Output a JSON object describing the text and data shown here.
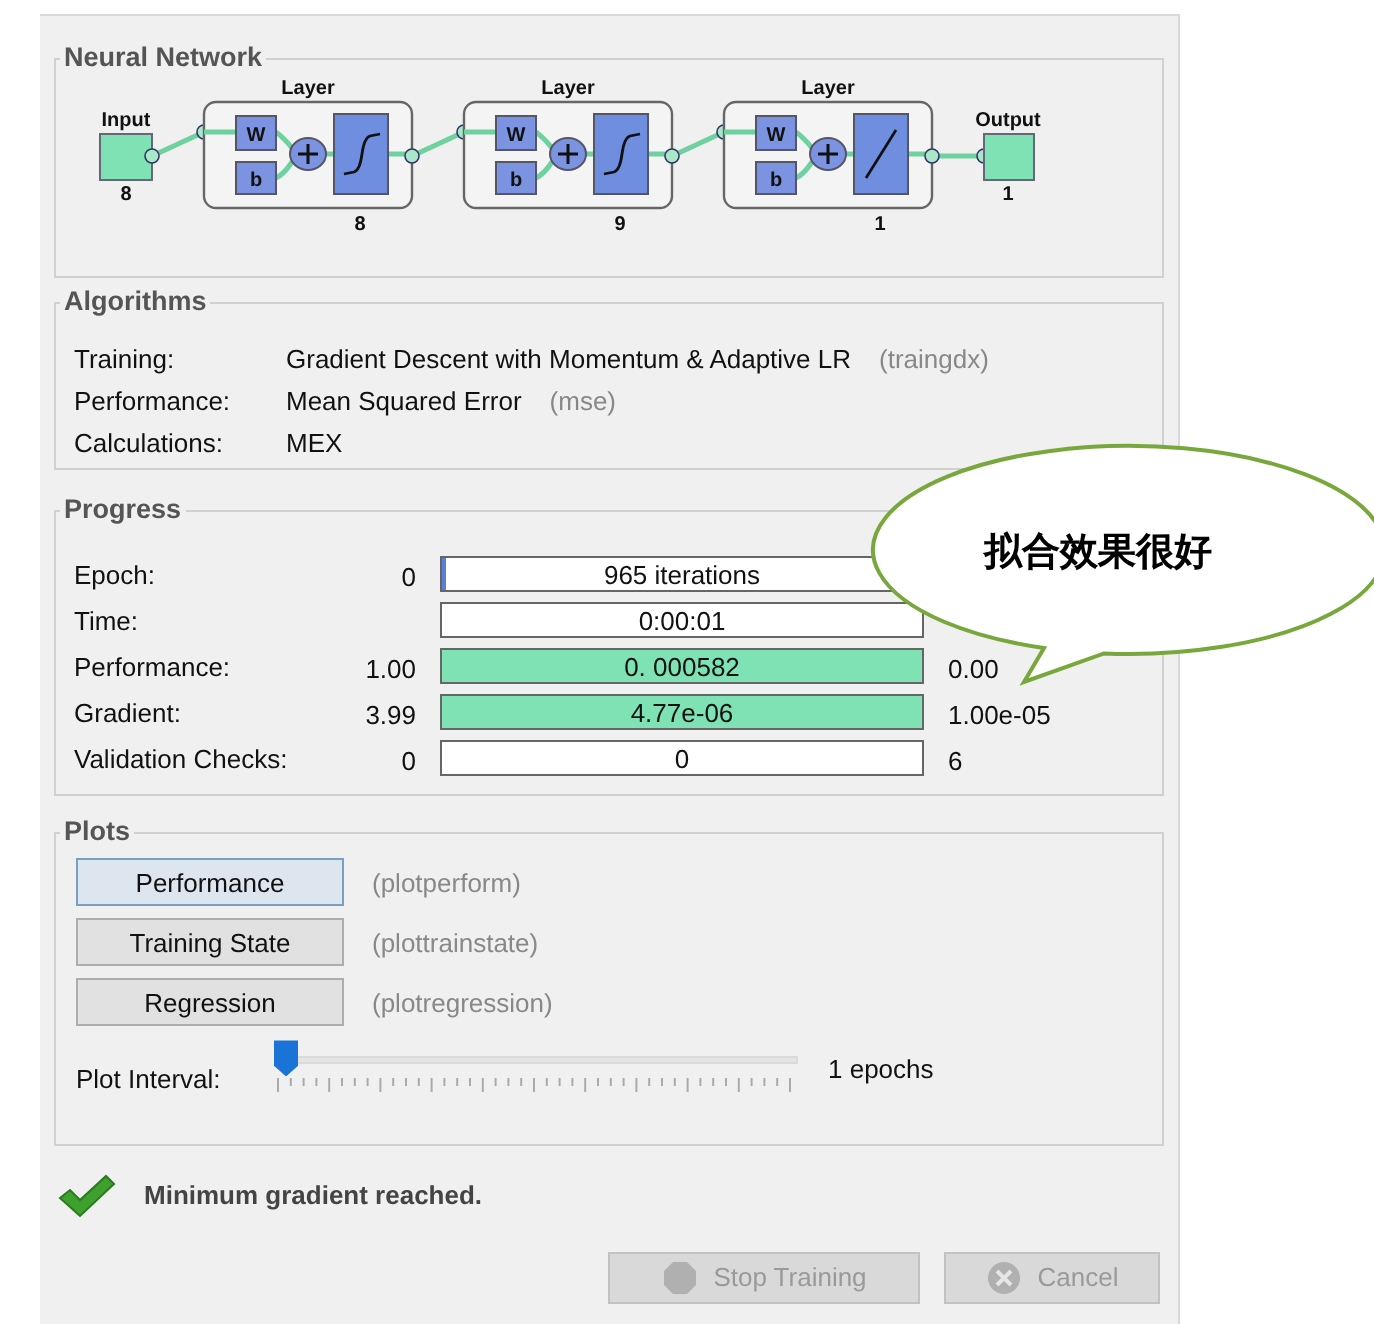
{
  "network": {
    "title": "Neural Network",
    "input": {
      "label": "Input",
      "size": "8"
    },
    "layers": [
      {
        "label": "Layer",
        "size": "8",
        "weight": "W",
        "bias": "b",
        "kind": "sigmoid"
      },
      {
        "label": "Layer",
        "size": "9",
        "weight": "W",
        "bias": "b",
        "kind": "sigmoid"
      },
      {
        "label": "Layer",
        "size": "1",
        "weight": "W",
        "bias": "b",
        "kind": "linear"
      }
    ],
    "output": {
      "label": "Output",
      "size": "1"
    }
  },
  "algorithms": {
    "title": "Algorithms",
    "rows": [
      {
        "label": "Training:",
        "value": "Gradient Descent with Momentum & Adaptive LR",
        "code": "(traingdx)"
      },
      {
        "label": "Performance:",
        "value": "Mean Squared Error",
        "code": "(mse)"
      },
      {
        "label": "Calculations:",
        "value": "MEX"
      }
    ]
  },
  "progress": {
    "title": "Progress",
    "rows": [
      {
        "label": "Epoch:",
        "start": "0",
        "bar_text": "965 iterations",
        "level": 0.01,
        "color": "#5b7fd6"
      },
      {
        "label": "Time:",
        "bar_text": "0:00:01"
      },
      {
        "label": "Performance:",
        "start": "1.00",
        "bar_text": "0. 000582",
        "end": "0.00",
        "level": 1,
        "color": "#7ee2b4"
      },
      {
        "label": "Gradient:",
        "start": "3.99",
        "bar_text": "4.77e-06",
        "end": "1.00e-05",
        "level": 1,
        "color": "#7ee2b4"
      },
      {
        "label": "Validation Checks:",
        "start": "0",
        "bar_text": "0",
        "end": "6"
      }
    ]
  },
  "plots": {
    "title": "Plots",
    "buttons": [
      {
        "label": "Performance",
        "code": "(plotperform)",
        "selected": true
      },
      {
        "label": "Training State",
        "code": "(plottrainstate)",
        "selected": false
      },
      {
        "label": "Regression",
        "code": "(plotregression)",
        "selected": false
      }
    ],
    "interval": {
      "label": "Plot Interval:",
      "level": 0,
      "reading": "1 epochs"
    }
  },
  "status": {
    "text": "Minimum gradient reached."
  },
  "buttons": [
    {
      "label": "Stop Training",
      "kind": "stop",
      "disabled": true
    },
    {
      "label": "Cancel",
      "kind": "cancel",
      "disabled": true
    }
  ],
  "callout": {
    "text": "拟合效果很好"
  }
}
